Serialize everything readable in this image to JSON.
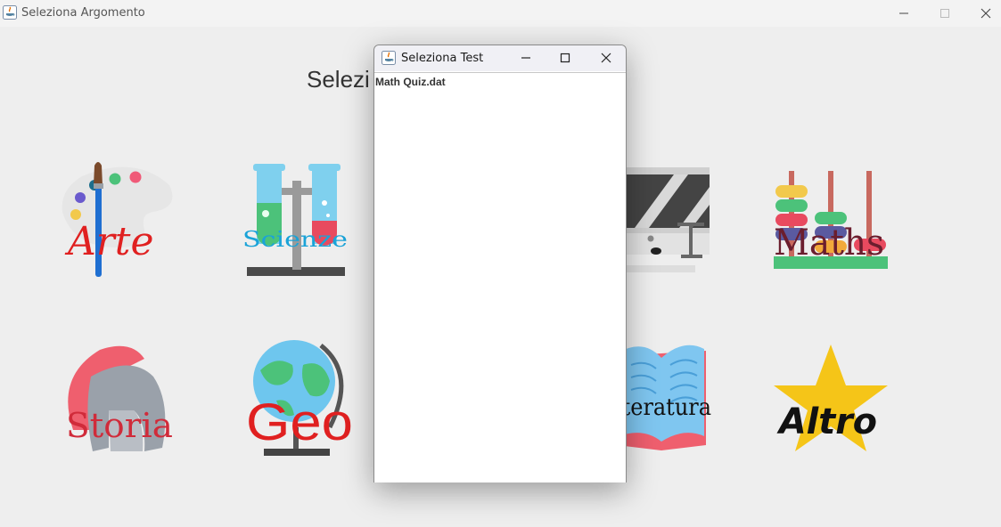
{
  "window": {
    "title": "Seleziona Argomento",
    "minimize_icon": "minimize-icon",
    "maximize_icon": "maximize-icon",
    "close_icon": "close-icon"
  },
  "main": {
    "heading": "Selezi",
    "topics": [
      {
        "label": "Arte",
        "icon": "palette-icon"
      },
      {
        "label": "Scienze",
        "icon": "test-tubes-icon"
      },
      {
        "label": "Maths",
        "icon": "abacus-icon"
      },
      {
        "label": "Storia",
        "icon": "helmet-icon"
      },
      {
        "label": "Geo",
        "icon": "globe-icon"
      },
      {
        "label": "tteratura",
        "icon": "book-icon"
      },
      {
        "label": "Altro",
        "icon": "star-icon"
      }
    ]
  },
  "dialog": {
    "title": "Seleziona Test",
    "files": [
      "Math Quiz.dat"
    ]
  },
  "colors": {
    "background": "#eeeeee",
    "dialog_bg": "#ffffff",
    "arte_text": "#e02020",
    "star": "#f5c518"
  }
}
